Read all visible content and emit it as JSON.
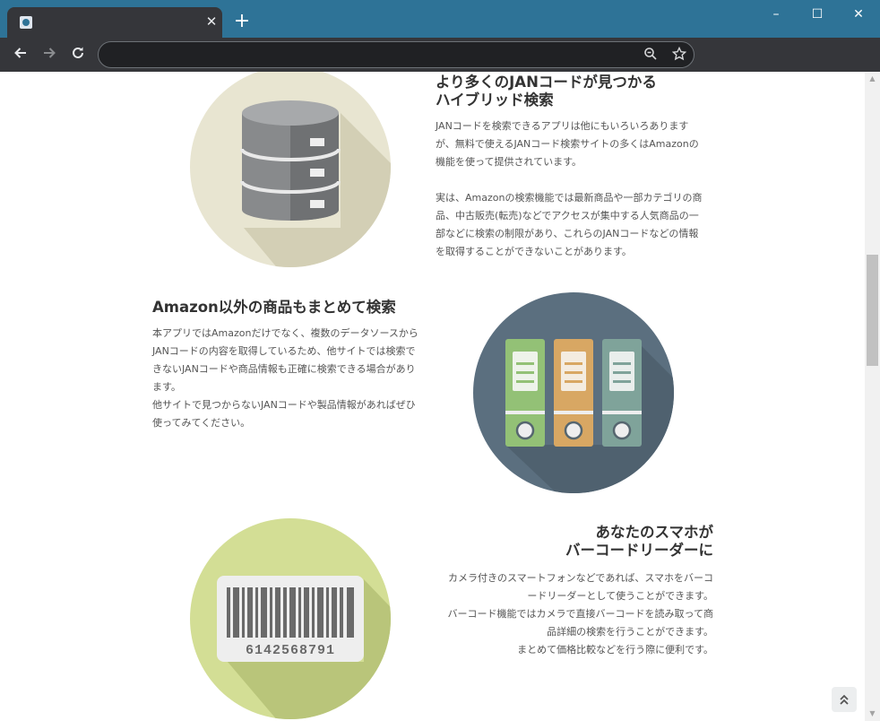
{
  "browser": {
    "tab_title": "",
    "tab_close": "✕",
    "new_tab": "+",
    "window_buttons": {
      "minimize": "–",
      "maximize": "☐",
      "close": "✕"
    },
    "address_value": ""
  },
  "colors": {
    "titlebar": "#2e7397",
    "toolbar": "#35363a",
    "circle_database_bg": "#e8e5d1",
    "circle_binders_bg": "#5b6f7f",
    "circle_barcode_bg": "#d3de95",
    "heading_text": "#333333",
    "body_text": "#555555"
  },
  "sections": [
    {
      "icon": "database-icon",
      "title_lines": [
        "より多くのJANコードが見つかる",
        "ハイブリッド検索"
      ],
      "paragraph_lines": [
        "JANコードを検索できるアプリは他にもいろいろあります",
        "が、無料で使えるJANコード検索サイトの多くはAmazonの",
        "機能を使って提供されています。",
        "",
        "実は、Amazonの検索機能では最新商品や一部カテゴリの商",
        "品、中古販売(転売)などでアクセスが集中する人気商品の一",
        "部などに検索の制限があり、これらのJANコードなどの情報",
        "を取得することができないことがあります。"
      ]
    },
    {
      "icon": "binders-icon",
      "title_lines": [
        "Amazon以外の商品もまとめて検索"
      ],
      "paragraph_lines": [
        "本アプリではAmazonだけでなく、複数のデータソースから",
        "JANコードの内容を取得しているため、他サイトでは検索で",
        "きないJANコードや商品情報も正確に検索できる場合があり",
        "ます。",
        "他サイトで見つからないJANコードや製品情報があればぜひ",
        "使ってみてください。"
      ]
    },
    {
      "icon": "barcode-icon",
      "barcode_number": "6142568791",
      "title_lines": [
        "あなたのスマホが",
        "バーコードリーダーに"
      ],
      "paragraph_lines": [
        "カメラ付きのスマートフォンなどであれば、スマホをバーコ",
        "ードリーダーとして使うことができます。",
        "バーコード機能ではカメラで直接バーコードを読み取って商",
        "品詳細の検索を行うことができます。",
        "まとめて価格比較などを行う際に便利です。"
      ]
    }
  ],
  "back_to_top_icon": "double-chevron-up-icon"
}
